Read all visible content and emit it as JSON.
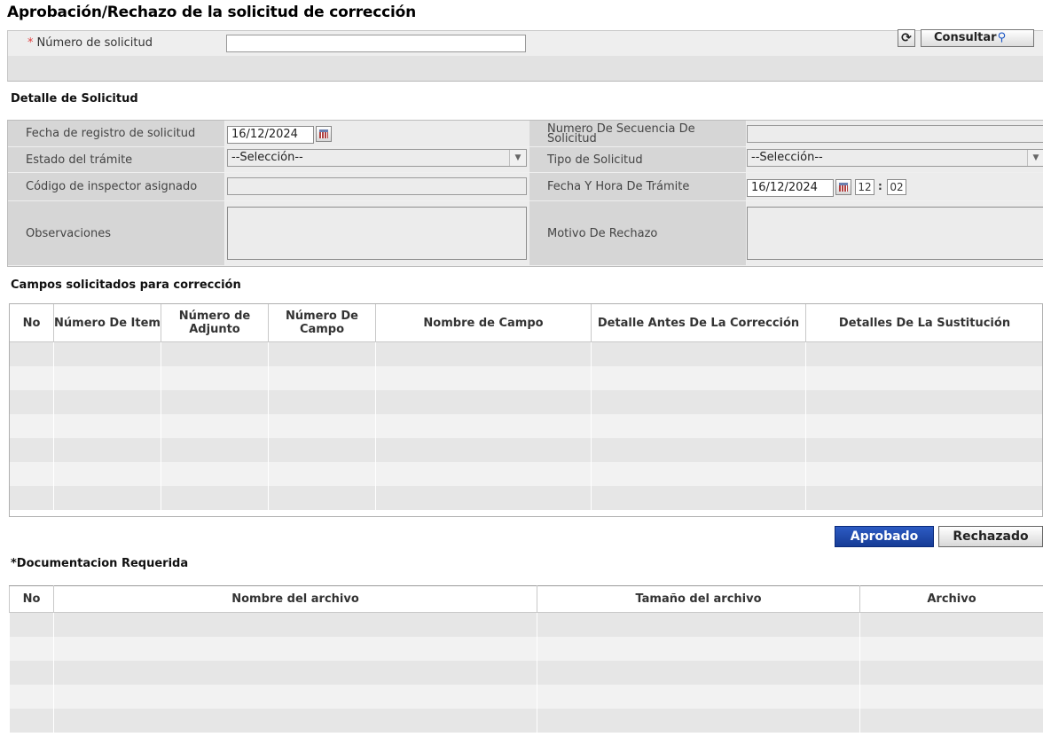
{
  "page": {
    "title": "Aprobación/Rechazo de la solicitud de corrección"
  },
  "search": {
    "required_mark": "*",
    "label": "Número de solicitud",
    "value": "",
    "reset_icon": "refresh-icon",
    "consultar_label": "Consultar",
    "consultar_icon": "magnifier-icon"
  },
  "detail": {
    "section_title": "Detalle de Solicitud",
    "fecha_registro_label": "Fecha de registro de solicitud",
    "fecha_registro_value": "16/12/2024",
    "numero_secuencia_label": "Numero De Secuencia De Solicitud",
    "numero_secuencia_value": "",
    "estado_label": "Estado del trámite",
    "estado_value": "--Selección--",
    "tipo_label": "Tipo de Solicitud",
    "tipo_value": "--Selección--",
    "codigo_inspector_label": "Código de inspector asignado",
    "codigo_inspector_value": "",
    "fecha_hora_label": "Fecha Y Hora De Trámite",
    "fecha_hora_date": "16/12/2024",
    "fecha_hora_hour": "12",
    "time_separator": ":",
    "fecha_hora_minute": "02",
    "observaciones_label": "Observaciones",
    "observaciones_value": "",
    "motivo_label": "Motivo De Rechazo",
    "motivo_value": ""
  },
  "campos": {
    "section_title": "Campos solicitados para corrección",
    "columns": [
      "No",
      "Número De Item",
      "Número de Adjunto",
      "Número De Campo",
      "Nombre de Campo",
      "Detalle Antes De La Corrección",
      "Detalles De La Sustitución"
    ],
    "row_count": 7
  },
  "actions": {
    "aprobado_label": "Aprobado",
    "rechazado_label": "Rechazado"
  },
  "documentacion": {
    "section_title": "*Documentacion Requerida",
    "columns": [
      "No",
      "Nombre del archivo",
      "Tamaño del archivo",
      "Archivo"
    ],
    "row_count": 5
  },
  "colors": {
    "primary_button": "#1f4aa8",
    "header_bg": "#ffffff",
    "row_odd": "#e6e6e6",
    "row_even": "#f2f2f2",
    "required": "#e04040"
  }
}
